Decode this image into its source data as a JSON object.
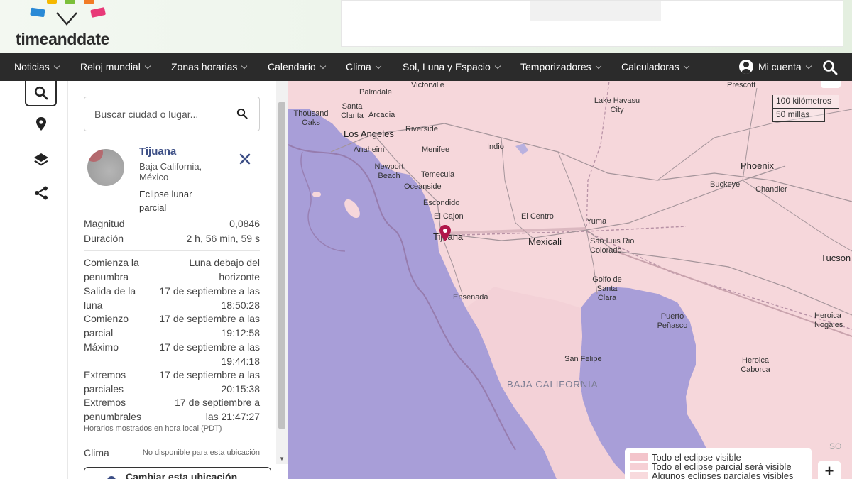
{
  "site": {
    "logo_text": "timeanddate"
  },
  "nav": {
    "items": [
      "Noticias",
      "Reloj mundial",
      "Zonas horarias",
      "Calendario",
      "Clima",
      "Sol, Luna y Espacio",
      "Temporizadores",
      "Calculadoras"
    ],
    "account_label": "Mi cuenta"
  },
  "tools": {
    "icons": [
      "search-icon",
      "location-pin-icon",
      "layers-icon",
      "share-icon"
    ]
  },
  "panel": {
    "search_placeholder": "Buscar ciudad o lugar...",
    "place": {
      "name": "Tijuana",
      "region": "Baja California, México",
      "eclipse_type": "Eclipse lunar parcial"
    },
    "summary": [
      {
        "label": "Magnitud",
        "value": "0,0846"
      },
      {
        "label": "Duración",
        "value": "2 h, 56 min, 59 s"
      }
    ],
    "times": [
      {
        "label": "Comienza la penumbra",
        "value": "Luna debajo del horizonte"
      },
      {
        "label": "Salida de la luna",
        "value": "17 de septiembre a las 18:50:28"
      },
      {
        "label": "Comienzo parcial",
        "value": "17 de septiembre a las 19:12:58"
      },
      {
        "label": "Máximo",
        "value": "17 de septiembre a las 19:44:18"
      },
      {
        "label": "Extremos parciales",
        "value": "17 de septiembre a las 20:15:38"
      },
      {
        "label": "Extremos penumbrales",
        "value": "17 de septiembre a las 21:47:27"
      }
    ],
    "footnote": "Horarios mostrados en hora local (PDT)",
    "weather_label": "Clima",
    "weather_value": "No disponible para esta ubicación",
    "location_button": "Cambiar esta ubicación"
  },
  "map": {
    "cities": [
      "Victorville",
      "Palmdale",
      "Santa Clarita",
      "Thousand Oaks",
      "Arcadia",
      "Los Angeles",
      "Riverside",
      "Anaheim",
      "Menifee",
      "Newport Beach",
      "Temecula",
      "Oceanside",
      "Escondido",
      "El Cajon",
      "Tijuana",
      "Indio",
      "El Centro",
      "Mexicali",
      "Yuma",
      "San Luis Rio Colorado",
      "Lake Havasu City",
      "Phoenix",
      "Buckeye",
      "Chandler",
      "Prescott",
      "Tucson",
      "Ensenada",
      "Golfo de Santa Clara",
      "Puerto Peñasco",
      "San Felipe",
      "Heroica Nogales",
      "Heroica Caborca"
    ],
    "region_label": "BAJA CALIFORNIA",
    "scale_km": "100 kilómetros",
    "scale_mi": "50 millas",
    "edge_fragment": "SO",
    "legend": [
      {
        "label": "Todo el eclipse visible",
        "color": "#f3c4cb"
      },
      {
        "label": "Todo el eclipse parcial será visible",
        "color": "#f6d0d5"
      },
      {
        "label": "Algunos eclipses parciales visibles",
        "color": "#f8dadd"
      }
    ],
    "colors": {
      "land": "#f6d7db",
      "water": "#a89ed8",
      "road": "#9a8a90",
      "pin": "#b0174a"
    },
    "zoom_in": "+"
  }
}
